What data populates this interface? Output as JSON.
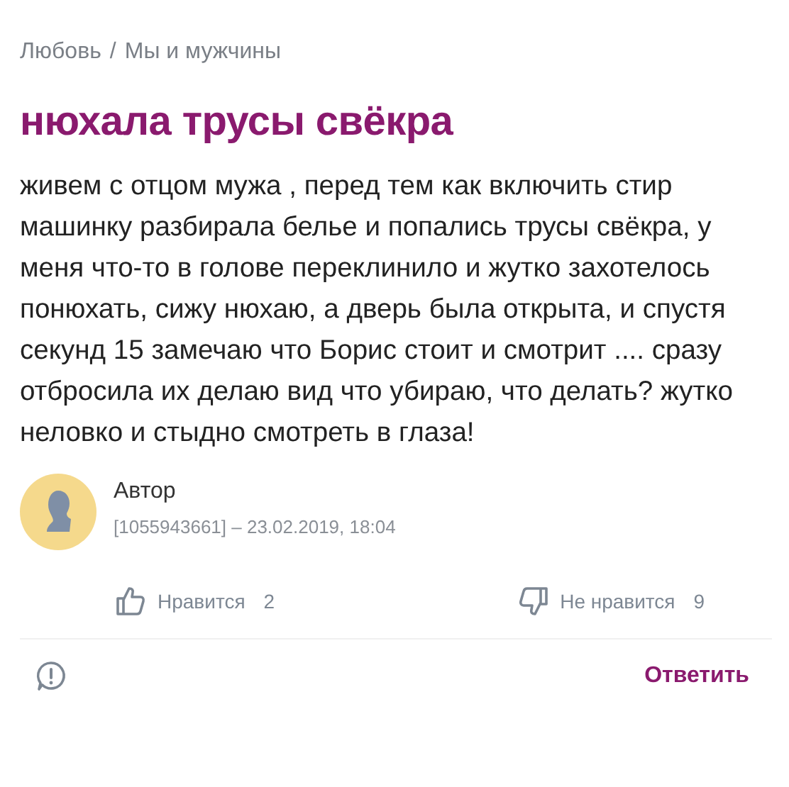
{
  "breadcrumbs": [
    {
      "label": "Любовь"
    },
    {
      "label": "Мы и мужчины"
    }
  ],
  "breadcrumb_separator": "/",
  "title": "нюхала трусы свёкра",
  "body": "живем с отцом мужа , перед тем как включить стир машинку разбирала белье и попались трусы свёкра, у меня что-то в голове переклинило и жутко захотелось понюхать, сижу нюхаю, а дверь была открыта, и спустя секунд 15 замечаю что Борис стоит и смотрит .... сразу отбросила их делаю вид что убираю, что делать? жутко неловко и стыдно смотреть в глаза!",
  "author": {
    "name": "Автор",
    "meta": "[1055943661] – 23.02.2019, 18:04"
  },
  "reactions": [
    {
      "kind": "like",
      "label": "Нравится",
      "count": "2"
    },
    {
      "kind": "dislike",
      "label": "Не нравится",
      "count": "9"
    }
  ],
  "reply_button": "Ответить"
}
